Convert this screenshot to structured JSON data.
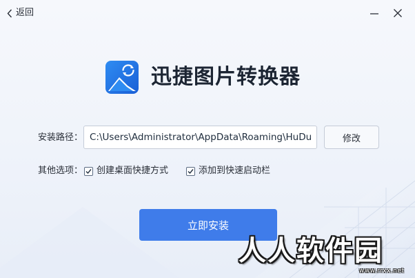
{
  "topbar": {
    "back_label": "返回",
    "back_icon": "chevron-left-icon",
    "minimize_icon": "minimize-icon",
    "close_icon": "close-icon"
  },
  "app": {
    "title": "迅捷图片转换器",
    "logo_icon": "image-convert-logo-icon",
    "accent_color": "#3f7cea"
  },
  "install_path": {
    "label": "安装路径：",
    "value": "C:\\Users\\Administrator\\AppData\\Roaming\\HuDun",
    "modify_label": "修改"
  },
  "options": {
    "label": "其他选项：",
    "items": [
      {
        "label": "创建桌面快捷方式",
        "checked": true
      },
      {
        "label": "添加到快速启动栏",
        "checked": true
      }
    ]
  },
  "install_button": {
    "label": "立即安装"
  },
  "watermark": {
    "text": "人人软件园",
    "url": "www.rrxx.net"
  }
}
